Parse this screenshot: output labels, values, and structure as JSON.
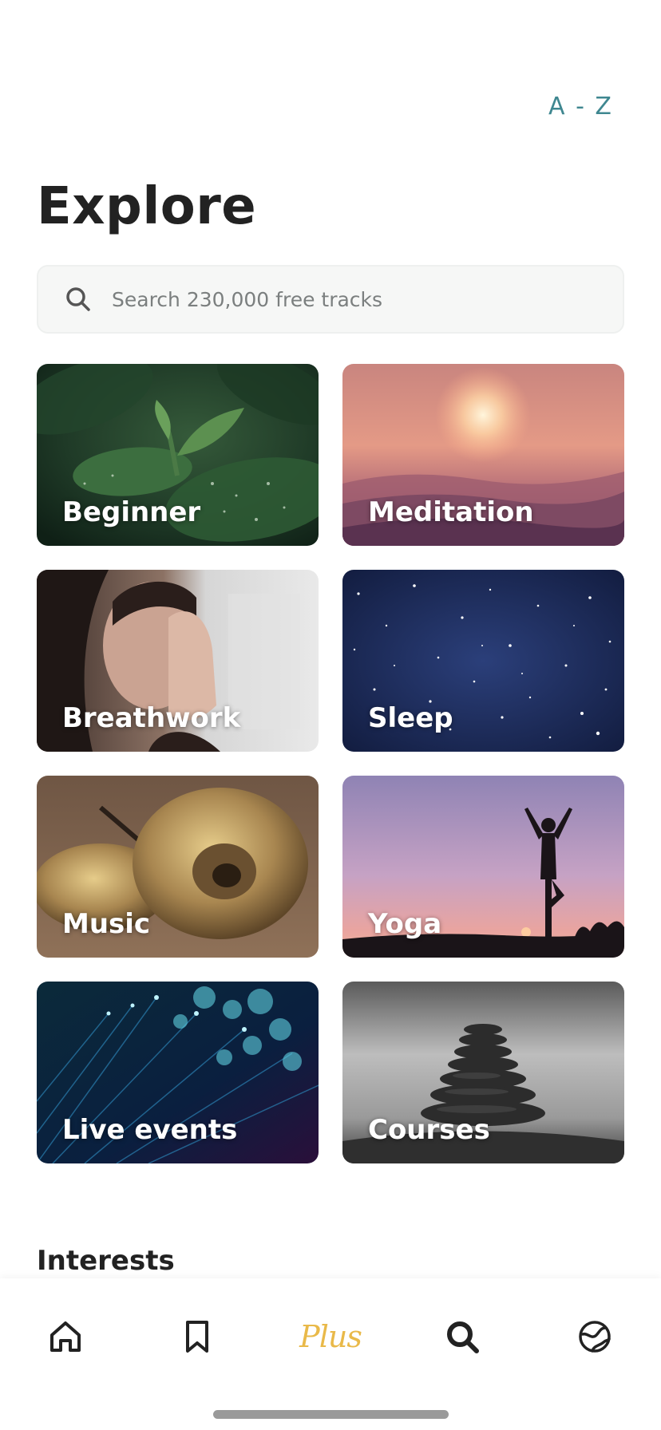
{
  "header": {
    "az_label": "A - Z",
    "title": "Explore"
  },
  "search": {
    "placeholder": "Search 230,000 free tracks",
    "icon": "search-icon"
  },
  "categories": [
    {
      "label": "Beginner",
      "art": "leaf"
    },
    {
      "label": "Meditation",
      "art": "sunset"
    },
    {
      "label": "Breathwork",
      "art": "person"
    },
    {
      "label": "Sleep",
      "art": "stars"
    },
    {
      "label": "Music",
      "art": "cymbals"
    },
    {
      "label": "Yoga",
      "art": "yoga"
    },
    {
      "label": "Live events",
      "art": "lights"
    },
    {
      "label": "Courses",
      "art": "stones"
    }
  ],
  "interests": {
    "title": "Interests"
  },
  "tab_bar": {
    "items": [
      {
        "name": "home",
        "icon": "home-icon"
      },
      {
        "name": "saved",
        "icon": "bookmark-icon"
      },
      {
        "name": "plus",
        "label": "Plus"
      },
      {
        "name": "search",
        "icon": "search-icon",
        "active": true
      },
      {
        "name": "community",
        "icon": "globe-icon"
      }
    ],
    "plus_color": "#e9b949"
  },
  "colors": {
    "accent": "#3f8790",
    "plus": "#e9b949",
    "title": "#222222"
  }
}
